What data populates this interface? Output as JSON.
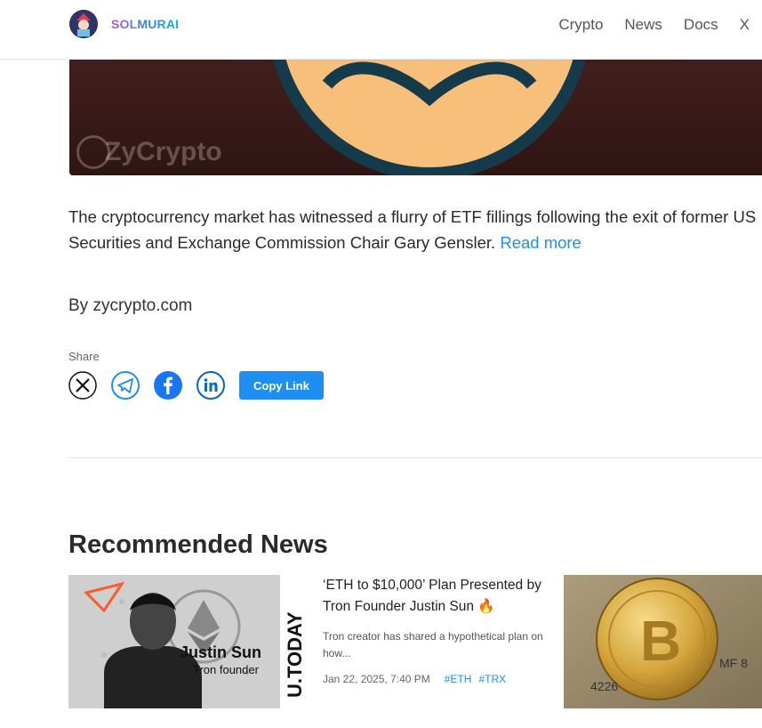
{
  "header": {
    "brand": "SOLMURAI",
    "nav": [
      "Crypto",
      "News",
      "Docs",
      "X"
    ]
  },
  "hero": {
    "watermark": "ZyCrypto"
  },
  "article": {
    "summary": "The cryptocurrency market has witnessed a flurry of ETF fillings following the exit of former US Securities and Exchange Commission Chair Gary Gensler.",
    "read_more": "Read more",
    "byline": "By zycrypto.com"
  },
  "share": {
    "label": "Share",
    "copy_link": "Copy Link",
    "icons": [
      "x-icon",
      "telegram-icon",
      "facebook-icon",
      "linkedin-icon"
    ]
  },
  "recommended": {
    "title": "Recommended News",
    "cards": [
      {
        "headline": "‘ETH to $10,000’ Plan Presented by Tron Founder Justin Sun",
        "fire": "🔥",
        "description": "Tron creator has shared a hypothetical plan on how...",
        "date": "Jan 22, 2025, 7:40 PM",
        "tags": [
          "#ETH",
          "#TRX"
        ],
        "image_name": "Justin Sun",
        "image_caption": "Tron founder",
        "image_side": "U.TODAY"
      },
      {
        "image": "bitcoin-coin-image"
      }
    ]
  },
  "colors": {
    "accent": "#1f8ef1",
    "text": "#2a2a2a"
  }
}
